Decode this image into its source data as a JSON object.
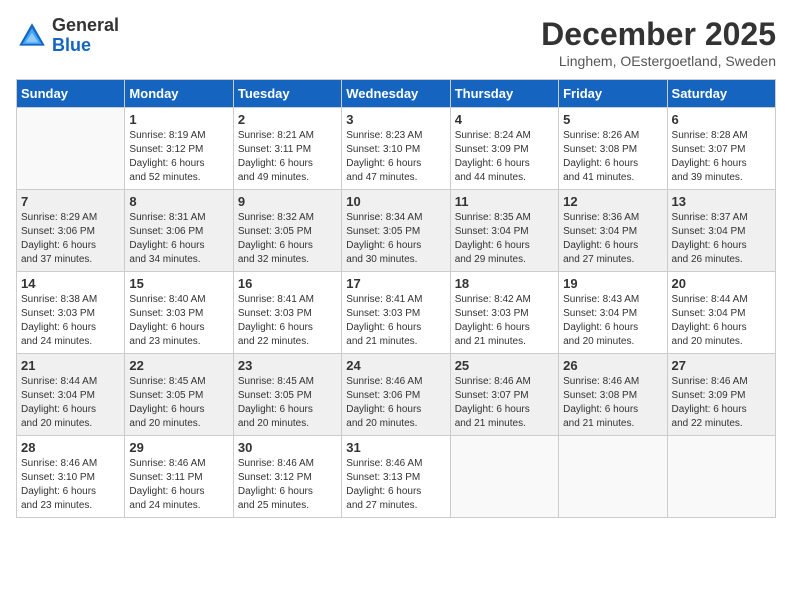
{
  "header": {
    "logo_general": "General",
    "logo_blue": "Blue",
    "month": "December 2025",
    "location": "Linghem, OEstergoetland, Sweden"
  },
  "days_of_week": [
    "Sunday",
    "Monday",
    "Tuesday",
    "Wednesday",
    "Thursday",
    "Friday",
    "Saturday"
  ],
  "weeks": [
    [
      {
        "day": "",
        "info": ""
      },
      {
        "day": "1",
        "info": "Sunrise: 8:19 AM\nSunset: 3:12 PM\nDaylight: 6 hours\nand 52 minutes."
      },
      {
        "day": "2",
        "info": "Sunrise: 8:21 AM\nSunset: 3:11 PM\nDaylight: 6 hours\nand 49 minutes."
      },
      {
        "day": "3",
        "info": "Sunrise: 8:23 AM\nSunset: 3:10 PM\nDaylight: 6 hours\nand 47 minutes."
      },
      {
        "day": "4",
        "info": "Sunrise: 8:24 AM\nSunset: 3:09 PM\nDaylight: 6 hours\nand 44 minutes."
      },
      {
        "day": "5",
        "info": "Sunrise: 8:26 AM\nSunset: 3:08 PM\nDaylight: 6 hours\nand 41 minutes."
      },
      {
        "day": "6",
        "info": "Sunrise: 8:28 AM\nSunset: 3:07 PM\nDaylight: 6 hours\nand 39 minutes."
      }
    ],
    [
      {
        "day": "7",
        "info": "Sunrise: 8:29 AM\nSunset: 3:06 PM\nDaylight: 6 hours\nand 37 minutes."
      },
      {
        "day": "8",
        "info": "Sunrise: 8:31 AM\nSunset: 3:06 PM\nDaylight: 6 hours\nand 34 minutes."
      },
      {
        "day": "9",
        "info": "Sunrise: 8:32 AM\nSunset: 3:05 PM\nDaylight: 6 hours\nand 32 minutes."
      },
      {
        "day": "10",
        "info": "Sunrise: 8:34 AM\nSunset: 3:05 PM\nDaylight: 6 hours\nand 30 minutes."
      },
      {
        "day": "11",
        "info": "Sunrise: 8:35 AM\nSunset: 3:04 PM\nDaylight: 6 hours\nand 29 minutes."
      },
      {
        "day": "12",
        "info": "Sunrise: 8:36 AM\nSunset: 3:04 PM\nDaylight: 6 hours\nand 27 minutes."
      },
      {
        "day": "13",
        "info": "Sunrise: 8:37 AM\nSunset: 3:04 PM\nDaylight: 6 hours\nand 26 minutes."
      }
    ],
    [
      {
        "day": "14",
        "info": "Sunrise: 8:38 AM\nSunset: 3:03 PM\nDaylight: 6 hours\nand 24 minutes."
      },
      {
        "day": "15",
        "info": "Sunrise: 8:40 AM\nSunset: 3:03 PM\nDaylight: 6 hours\nand 23 minutes."
      },
      {
        "day": "16",
        "info": "Sunrise: 8:41 AM\nSunset: 3:03 PM\nDaylight: 6 hours\nand 22 minutes."
      },
      {
        "day": "17",
        "info": "Sunrise: 8:41 AM\nSunset: 3:03 PM\nDaylight: 6 hours\nand 21 minutes."
      },
      {
        "day": "18",
        "info": "Sunrise: 8:42 AM\nSunset: 3:03 PM\nDaylight: 6 hours\nand 21 minutes."
      },
      {
        "day": "19",
        "info": "Sunrise: 8:43 AM\nSunset: 3:04 PM\nDaylight: 6 hours\nand 20 minutes."
      },
      {
        "day": "20",
        "info": "Sunrise: 8:44 AM\nSunset: 3:04 PM\nDaylight: 6 hours\nand 20 minutes."
      }
    ],
    [
      {
        "day": "21",
        "info": "Sunrise: 8:44 AM\nSunset: 3:04 PM\nDaylight: 6 hours\nand 20 minutes."
      },
      {
        "day": "22",
        "info": "Sunrise: 8:45 AM\nSunset: 3:05 PM\nDaylight: 6 hours\nand 20 minutes."
      },
      {
        "day": "23",
        "info": "Sunrise: 8:45 AM\nSunset: 3:05 PM\nDaylight: 6 hours\nand 20 minutes."
      },
      {
        "day": "24",
        "info": "Sunrise: 8:46 AM\nSunset: 3:06 PM\nDaylight: 6 hours\nand 20 minutes."
      },
      {
        "day": "25",
        "info": "Sunrise: 8:46 AM\nSunset: 3:07 PM\nDaylight: 6 hours\nand 21 minutes."
      },
      {
        "day": "26",
        "info": "Sunrise: 8:46 AM\nSunset: 3:08 PM\nDaylight: 6 hours\nand 21 minutes."
      },
      {
        "day": "27",
        "info": "Sunrise: 8:46 AM\nSunset: 3:09 PM\nDaylight: 6 hours\nand 22 minutes."
      }
    ],
    [
      {
        "day": "28",
        "info": "Sunrise: 8:46 AM\nSunset: 3:10 PM\nDaylight: 6 hours\nand 23 minutes."
      },
      {
        "day": "29",
        "info": "Sunrise: 8:46 AM\nSunset: 3:11 PM\nDaylight: 6 hours\nand 24 minutes."
      },
      {
        "day": "30",
        "info": "Sunrise: 8:46 AM\nSunset: 3:12 PM\nDaylight: 6 hours\nand 25 minutes."
      },
      {
        "day": "31",
        "info": "Sunrise: 8:46 AM\nSunset: 3:13 PM\nDaylight: 6 hours\nand 27 minutes."
      },
      {
        "day": "",
        "info": ""
      },
      {
        "day": "",
        "info": ""
      },
      {
        "day": "",
        "info": ""
      }
    ]
  ]
}
